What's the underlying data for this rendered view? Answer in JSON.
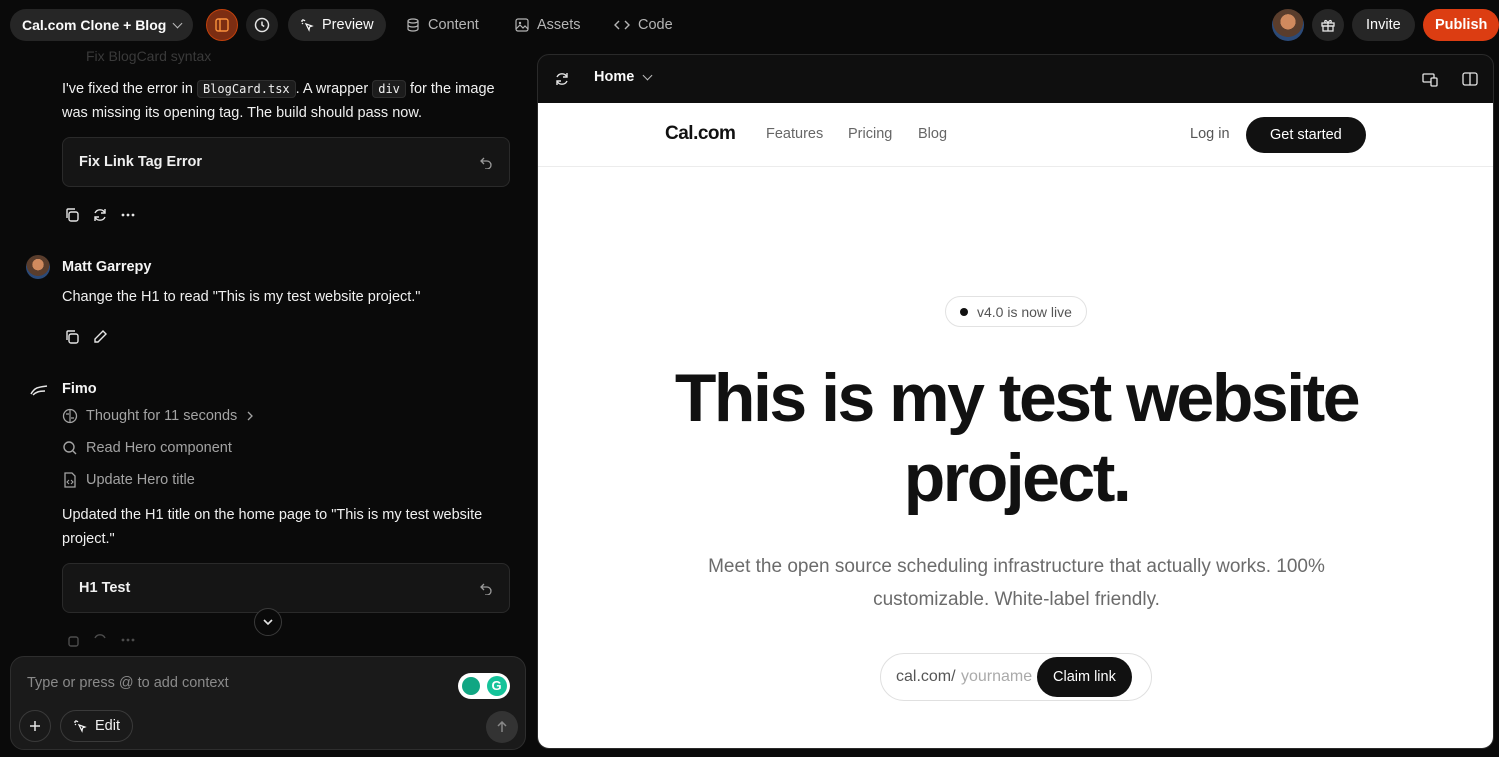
{
  "topbar": {
    "project_name": "Cal.com Clone + Blog",
    "tabs": [
      {
        "label": "Preview",
        "icon": "sparkle-pointer-icon",
        "active": true
      },
      {
        "label": "Content",
        "icon": "database-icon",
        "active": false
      },
      {
        "label": "Assets",
        "icon": "image-icon",
        "active": false
      },
      {
        "label": "Code",
        "icon": "code-icon",
        "active": false
      }
    ],
    "invite_label": "Invite",
    "publish_label": "Publish",
    "accent_color": "#dc3d12"
  },
  "chat": {
    "faded_previous": "Fix BlogCard syntax",
    "messages": {
      "first_text_pre": "I've fixed the error in",
      "first_code1": "BlogCard.tsx",
      "first_text_mid": ". A wrapper",
      "first_code2": "div",
      "first_text_post": "for the image was missing its opening tag. The build should pass now.",
      "card1_label": "Fix Link Tag Error",
      "user_name": "Matt Garrepy",
      "user_text": "Change the H1 to read \"This is my test website project.\"",
      "assistant_name": "Fimo",
      "steps": [
        "Thought for 11 seconds",
        "Read Hero component",
        "Update Hero title"
      ],
      "assistant_text": "Updated the H1 title on the home page to \"This is my test website project.\"",
      "card2_label": "H1 Test"
    }
  },
  "composer": {
    "placeholder": "Type or press @ to add context",
    "edit_label": "Edit"
  },
  "preview": {
    "page_select": "Home",
    "site": {
      "logo": "Cal.com",
      "nav": [
        "Features",
        "Pricing",
        "Blog"
      ],
      "login": "Log in",
      "cta": "Get started",
      "badge": "v4.0 is now live",
      "hero_title": "This is my test website project.",
      "subtitle": "Meet the open source scheduling infrastructure that actually works. 100% customizable. White-label friendly.",
      "claim_prefix": "cal.com/",
      "claim_placeholder": "yourname",
      "claim_button": "Claim link"
    }
  }
}
